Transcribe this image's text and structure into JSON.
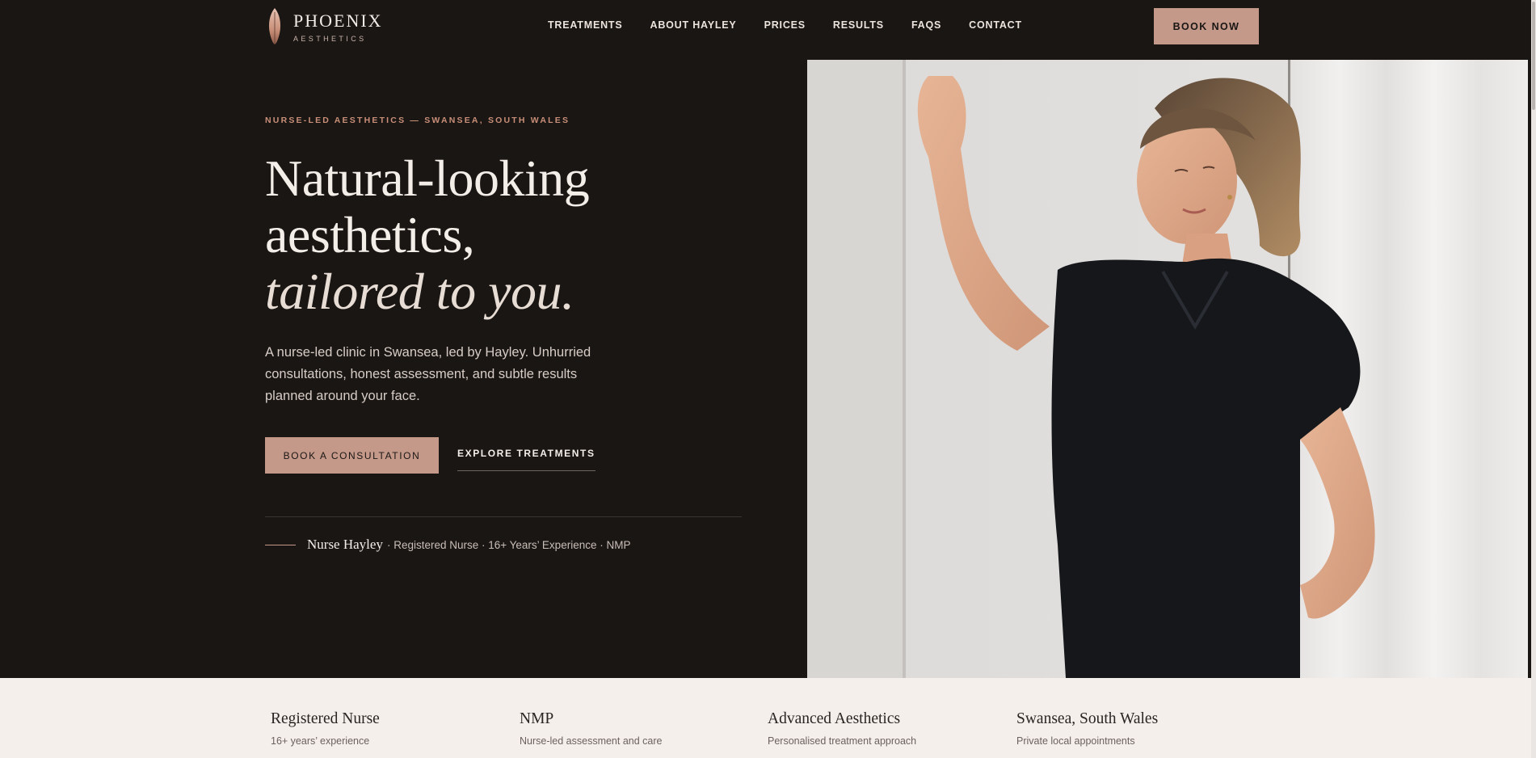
{
  "brand": {
    "name": "PHOENIX",
    "sub": "AESTHETICS"
  },
  "nav": {
    "items": [
      {
        "label": "TREATMENTS"
      },
      {
        "label": "ABOUT HAYLEY"
      },
      {
        "label": "PRICES"
      },
      {
        "label": "RESULTS"
      },
      {
        "label": "FAQS"
      },
      {
        "label": "CONTACT"
      }
    ],
    "book_now": "BOOK NOW"
  },
  "hero": {
    "eyebrow": "NURSE-LED AESTHETICS — SWANSEA, SOUTH WALES",
    "headline": {
      "line1": "Natural-looking",
      "line2": "aesthetics,",
      "line3": "tailored to you."
    },
    "lede": "A nurse-led clinic in Swansea, led by Hayley. Unhurried consultations, honest assessment, and subtle results planned around your face.",
    "cta_primary": "BOOK A CONSULTATION",
    "cta_secondary": "EXPLORE TREATMENTS",
    "credit_name": "Nurse Hayley",
    "credit_meta": "· Registered Nurse · 16+ Years’ Experience · NMP"
  },
  "highlights": [
    {
      "title": "Registered Nurse",
      "sub": "16+ years’ experience"
    },
    {
      "title": "NMP",
      "sub": "Nurse-led assessment and care"
    },
    {
      "title": "Advanced Aesthetics",
      "sub": "Personalised treatment approach"
    },
    {
      "title": "Swansea, South Wales",
      "sub": "Private local appointments"
    }
  ],
  "colors": {
    "background": "#1a1614",
    "accent": "#c4998a",
    "eyebrow": "#c98f78",
    "strip_bg": "#f4efeb"
  }
}
